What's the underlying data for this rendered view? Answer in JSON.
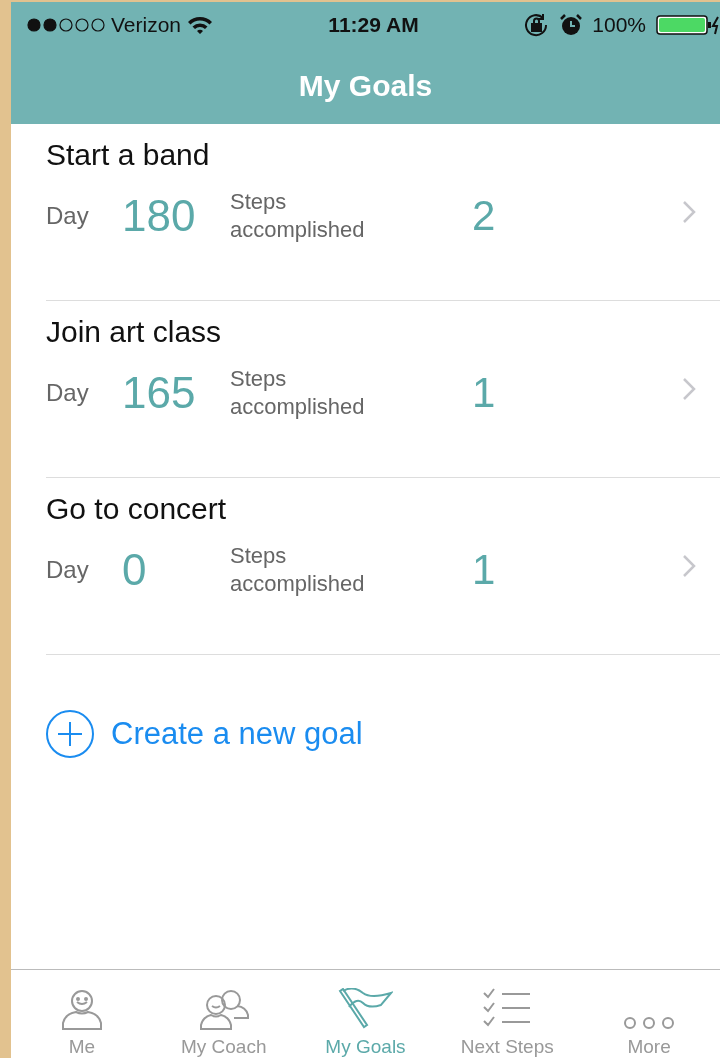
{
  "status_bar": {
    "carrier": "Verizon",
    "time": "11:29 AM",
    "battery": "100%"
  },
  "nav": {
    "title": "My Goals"
  },
  "goals": [
    {
      "title": "Start a band",
      "day_label": "Day",
      "day": "180",
      "steps_label": "Steps accomplished",
      "steps": "2"
    },
    {
      "title": "Join art class",
      "day_label": "Day",
      "day": "165",
      "steps_label": "Steps accomplished",
      "steps": "1"
    },
    {
      "title": "Go to concert",
      "day_label": "Day",
      "day": "0",
      "steps_label": "Steps accomplished",
      "steps": "1"
    }
  ],
  "create": {
    "label": "Create a new goal"
  },
  "tabs": [
    {
      "label": "Me",
      "kind": "me",
      "selected": false
    },
    {
      "label": "My Coach",
      "kind": "coach",
      "selected": false
    },
    {
      "label": "My Goals",
      "kind": "goals",
      "selected": true
    },
    {
      "label": "Next Steps",
      "kind": "steps",
      "selected": false
    },
    {
      "label": "More",
      "kind": "more",
      "selected": false
    }
  ]
}
